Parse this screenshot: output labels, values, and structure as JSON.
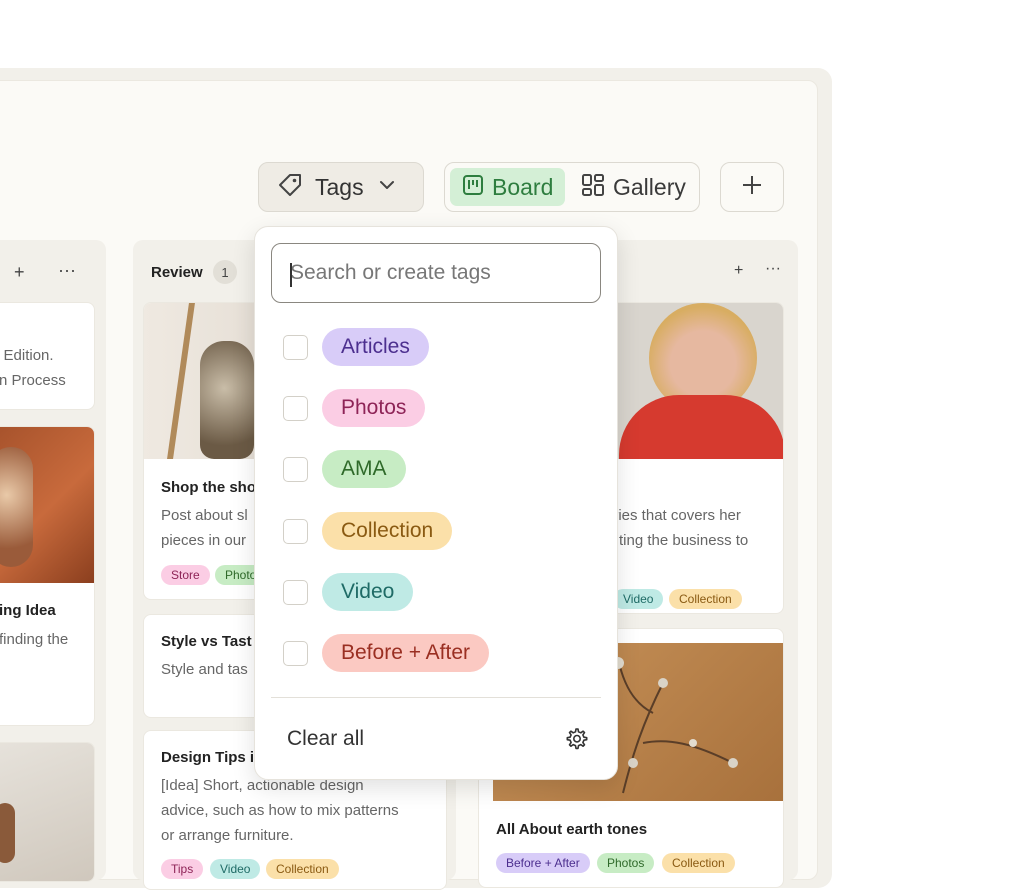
{
  "toolbar": {
    "tags_label": "Tags",
    "board_label": "Board",
    "gallery_label": "Gallery"
  },
  "colors": {
    "board_active_bg": "#d4efd6",
    "board_active_text": "#2e7d3f"
  },
  "left_column": {
    "card1_lines": [
      "g Edition.",
      "n Process"
    ],
    "card2_title": "ing Idea",
    "card2_line": "finding the"
  },
  "review_column": {
    "title": "Review",
    "count": "1",
    "cards": [
      {
        "title": "Shop the sho",
        "lines": [
          "Post about sl",
          "pieces in our"
        ],
        "tags": [
          "Store",
          "Photo"
        ]
      },
      {
        "title": "Style vs Tast",
        "lines": [
          "Style and tas"
        ]
      },
      {
        "title": "Design Tips i",
        "lines": [
          "[Idea] Short, actionable design",
          "advice, such as how to mix patterns",
          "or arrange furniture."
        ],
        "tags": [
          "Tips",
          "Video",
          "Collection"
        ]
      }
    ]
  },
  "right_column": {
    "card1_lines": [
      "eries that covers her",
      "ting the business to"
    ],
    "card1_tags": [
      "Video",
      "Collection"
    ],
    "card2_title": "All About earth tones",
    "card2_tags": [
      "Before + After",
      "Photos",
      "Collection"
    ]
  },
  "dropdown": {
    "search_placeholder": "Search or create tags",
    "tags": [
      {
        "label": "Articles",
        "bg": "#d8ccf8",
        "fg": "#4c2f8f"
      },
      {
        "label": "Photos",
        "bg": "#fbcde4",
        "fg": "#8e2457"
      },
      {
        "label": "AMA",
        "bg": "#c7ecc4",
        "fg": "#2f6a2a"
      },
      {
        "label": "Collection",
        "bg": "#fbe0a9",
        "fg": "#8a5a12"
      },
      {
        "label": "Video",
        "bg": "#bfeae5",
        "fg": "#1f6b66"
      },
      {
        "label": "Before + After",
        "bg": "#fbc9c2",
        "fg": "#9a2f22"
      }
    ],
    "clear_label": "Clear all"
  },
  "icons": [
    "tag-icon",
    "chevron-down-icon",
    "board-icon",
    "gallery-icon",
    "plus-icon",
    "more-icon",
    "gear-icon"
  ]
}
